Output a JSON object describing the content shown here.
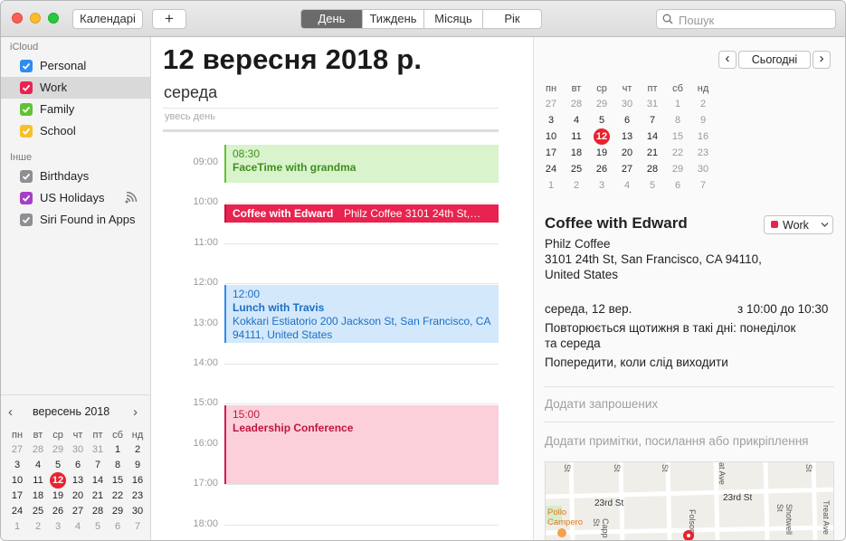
{
  "toolbar": {
    "calendars_button": "Календарі",
    "add_button": "+",
    "views": [
      {
        "label": "День",
        "active": true
      },
      {
        "label": "Тиждень",
        "active": false
      },
      {
        "label": "Місяць",
        "active": false
      },
      {
        "label": "Рік",
        "active": false
      }
    ],
    "search_placeholder": "Пошук"
  },
  "sidebar": {
    "groups": [
      {
        "title": "iCloud",
        "calendars": [
          {
            "name": "Personal",
            "color": "#2d8cf0",
            "selected": false
          },
          {
            "name": "Work",
            "color": "#e8234f",
            "selected": true
          },
          {
            "name": "Family",
            "color": "#5fc432",
            "selected": false
          },
          {
            "name": "School",
            "color": "#f7c02a",
            "selected": false
          }
        ]
      },
      {
        "title": "Інше",
        "calendars": [
          {
            "name": "Birthdays",
            "color": "#8e8e93",
            "selected": false
          },
          {
            "name": "US Holidays",
            "color": "#a53fc6",
            "selected": false,
            "icon": "broadcast-icon"
          },
          {
            "name": "Siri Found in Apps",
            "color": "#8e8e93",
            "selected": false
          }
        ]
      }
    ],
    "mini_calendar": {
      "month": "вересень 2018",
      "prev": "‹",
      "next": "›",
      "weekdays": [
        "пн",
        "вт",
        "ср",
        "чт",
        "пт",
        "сб",
        "нд"
      ],
      "weeks": [
        [
          "27",
          "28",
          "29",
          "30",
          "31",
          "1",
          "2"
        ],
        [
          "3",
          "4",
          "5",
          "6",
          "7",
          "8",
          "9"
        ],
        [
          "10",
          "11",
          "12",
          "13",
          "14",
          "15",
          "16"
        ],
        [
          "17",
          "18",
          "19",
          "20",
          "21",
          "22",
          "23"
        ],
        [
          "24",
          "25",
          "26",
          "27",
          "28",
          "29",
          "30"
        ],
        [
          "1",
          "2",
          "3",
          "4",
          "5",
          "6",
          "7"
        ]
      ],
      "today": "12"
    }
  },
  "day": {
    "title": "12 вересня 2018 р.",
    "weekday": "середа",
    "all_day_label": "увесь день",
    "hours": [
      "09:00",
      "10:00",
      "11:00",
      "12:00",
      "13:00",
      "14:00",
      "15:00",
      "16:00",
      "17:00",
      "18:00"
    ],
    "events": [
      {
        "time": "08:30",
        "title": "FaceTime with grandma",
        "location": "",
        "color": "#5fc432"
      },
      {
        "time": "",
        "title": "Coffee with Edward",
        "location": "Philz Coffee 3101 24th St,…",
        "color": "#e8234f"
      },
      {
        "time": "12:00",
        "title": "Lunch with Travis",
        "location": "Kokkari Estiatorio 200 Jackson St, San Francisco, CA  94111, United States",
        "color": "#2d8cf0"
      },
      {
        "time": "15:00",
        "title": "Leadership Conference",
        "location": "",
        "color": "#e8234f"
      }
    ]
  },
  "inspector": {
    "prev": "‹",
    "next": "›",
    "today_button": "Сьогодні",
    "mini_calendar": {
      "weekdays": [
        "пн",
        "вт",
        "ср",
        "чт",
        "пт",
        "сб",
        "нд"
      ],
      "weeks": [
        [
          "27",
          "28",
          "29",
          "30",
          "31",
          "1",
          "2"
        ],
        [
          "3",
          "4",
          "5",
          "6",
          "7",
          "8",
          "9"
        ],
        [
          "10",
          "11",
          "12",
          "13",
          "14",
          "15",
          "16"
        ],
        [
          "17",
          "18",
          "19",
          "20",
          "21",
          "22",
          "23"
        ],
        [
          "24",
          "25",
          "26",
          "27",
          "28",
          "29",
          "30"
        ],
        [
          "1",
          "2",
          "3",
          "4",
          "5",
          "6",
          "7"
        ]
      ],
      "today": "12"
    },
    "event_title": "Coffee with Edward",
    "calendar_label": "Work",
    "calendar_color": "#e8234f",
    "location_name": "Philz Coffee",
    "address_line1": "3101 24th St, San Francisco, CA  94110,",
    "address_line2": "United States",
    "date": "середа, 12 вер.",
    "time_range": "з 10:00 до 10:30",
    "repeat_line1": "Повторюється щотижня в такі дні: понеділок",
    "repeat_line2": "та середа",
    "alert": "Попередити, коли слід виходити",
    "add_invitees": "Додати запрошених",
    "add_notes": "Додати примітки, посилання або прикріплення",
    "map": {
      "streets": [
        "St",
        "St",
        "St",
        "at Ave",
        "St",
        "23rd St",
        "23rd St",
        "Folsom",
        "Capp St",
        "Shotwell St",
        "Treat Ave"
      ],
      "poi": "Pollo Campero"
    }
  }
}
